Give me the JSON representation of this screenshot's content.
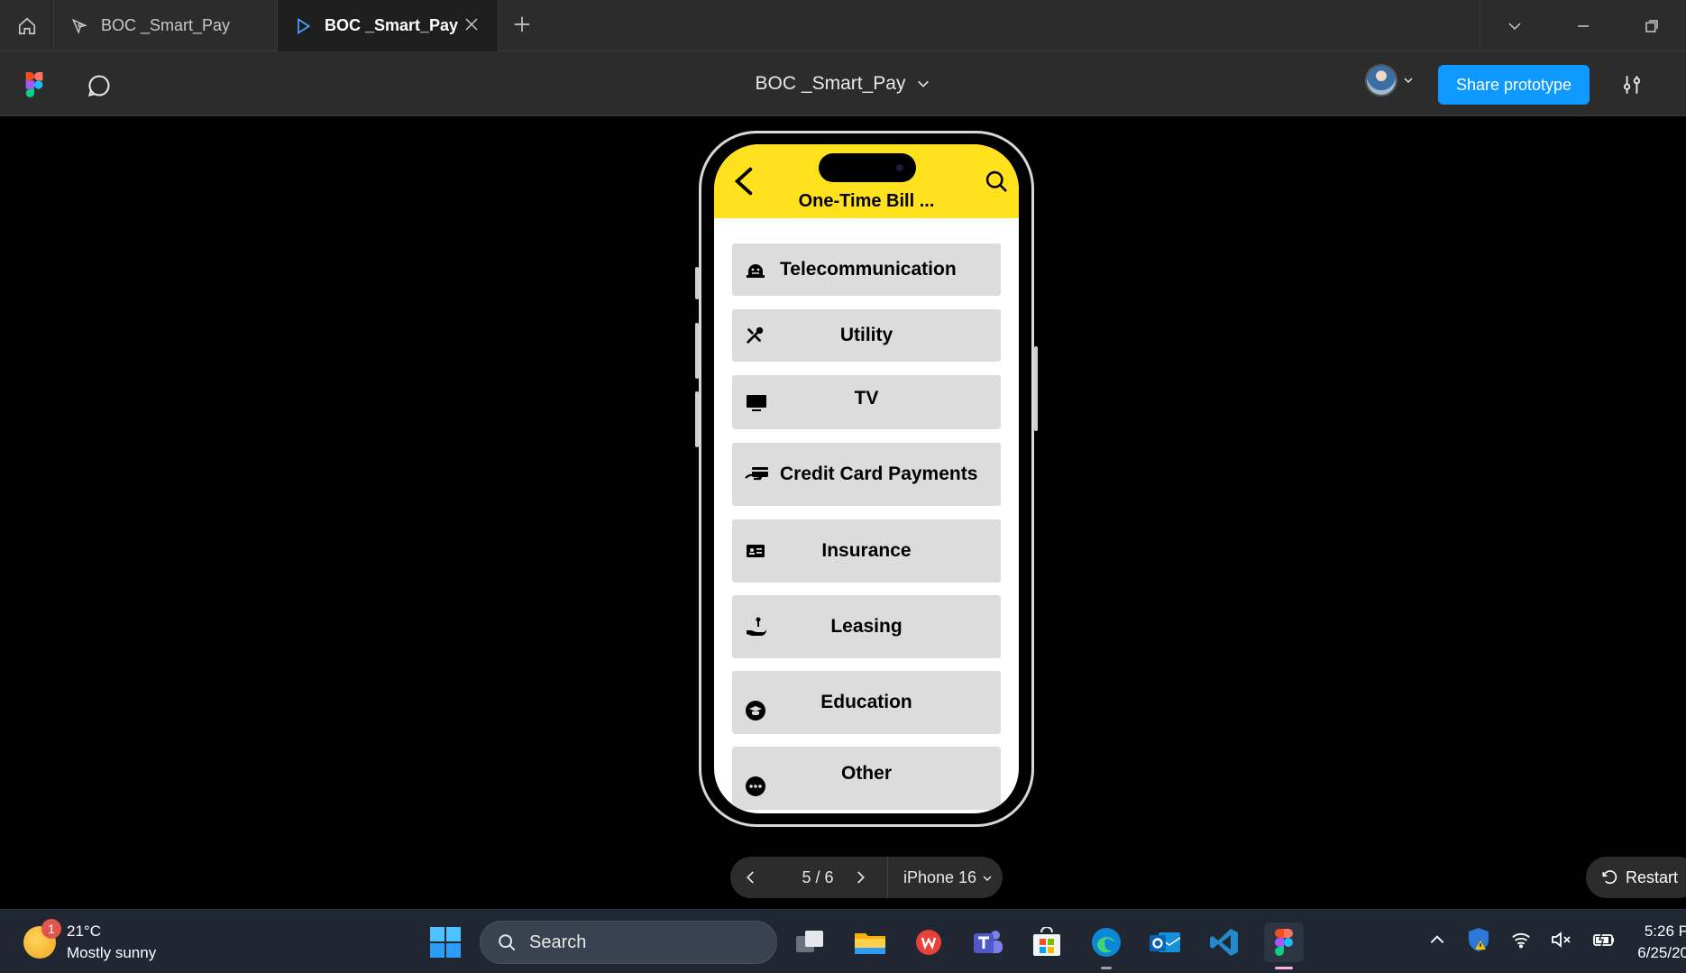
{
  "tabs": [
    {
      "label": "BOC _Smart_Pay",
      "icon": "figma-file-icon"
    },
    {
      "label": "BOC _Smart_Pay",
      "icon": "play-icon"
    }
  ],
  "toolbar": {
    "file_title": "BOC _Smart_Pay",
    "share_label": "Share prototype"
  },
  "app": {
    "title": "One-Time Bill ...",
    "header_color": "#ffe11d",
    "menu": [
      {
        "label": "Telecommunication",
        "icon": "telecom-icon"
      },
      {
        "label": "Utility",
        "icon": "tools-icon"
      },
      {
        "label": "TV",
        "icon": "tv-icon"
      },
      {
        "label": "Credit Card Payments",
        "icon": "credit-card-hand-icon"
      },
      {
        "label": "Insurance",
        "icon": "id-card-icon"
      },
      {
        "label": "Leasing",
        "icon": "hand-money-icon"
      },
      {
        "label": "Education",
        "icon": "graduation-icon"
      },
      {
        "label": "Other",
        "icon": "more-dots-icon"
      }
    ]
  },
  "navigator": {
    "page": "5 / 6",
    "device": "iPhone 16",
    "restart_label": "Restart"
  },
  "taskbar": {
    "weather_temp": "21°C",
    "weather_desc": "Mostly sunny",
    "weather_badge": "1",
    "search_placeholder": "Search",
    "time": "5:26 P",
    "date": "6/25/20"
  },
  "colors": {
    "accent": "#0d99ff",
    "app_yellow": "#ffe11d",
    "menu_bg": "#dcdcdc"
  }
}
